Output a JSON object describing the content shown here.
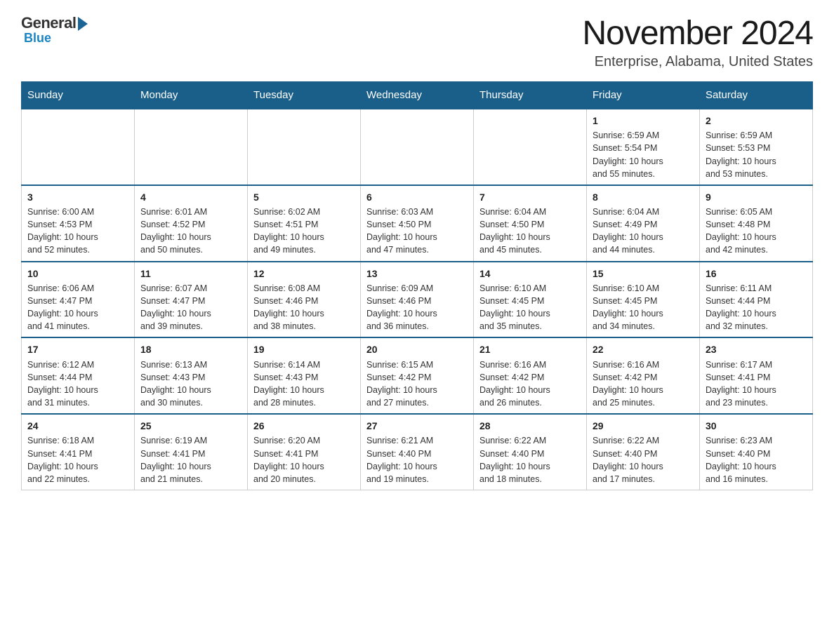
{
  "header": {
    "logo": {
      "general": "General",
      "blue": "Blue"
    },
    "title": "November 2024",
    "subtitle": "Enterprise, Alabama, United States"
  },
  "calendar": {
    "days_of_week": [
      "Sunday",
      "Monday",
      "Tuesday",
      "Wednesday",
      "Thursday",
      "Friday",
      "Saturday"
    ],
    "weeks": [
      {
        "days": [
          {
            "date": "",
            "info": ""
          },
          {
            "date": "",
            "info": ""
          },
          {
            "date": "",
            "info": ""
          },
          {
            "date": "",
            "info": ""
          },
          {
            "date": "",
            "info": ""
          },
          {
            "date": "1",
            "info": "Sunrise: 6:59 AM\nSunset: 5:54 PM\nDaylight: 10 hours\nand 55 minutes."
          },
          {
            "date": "2",
            "info": "Sunrise: 6:59 AM\nSunset: 5:53 PM\nDaylight: 10 hours\nand 53 minutes."
          }
        ]
      },
      {
        "days": [
          {
            "date": "3",
            "info": "Sunrise: 6:00 AM\nSunset: 4:53 PM\nDaylight: 10 hours\nand 52 minutes."
          },
          {
            "date": "4",
            "info": "Sunrise: 6:01 AM\nSunset: 4:52 PM\nDaylight: 10 hours\nand 50 minutes."
          },
          {
            "date": "5",
            "info": "Sunrise: 6:02 AM\nSunset: 4:51 PM\nDaylight: 10 hours\nand 49 minutes."
          },
          {
            "date": "6",
            "info": "Sunrise: 6:03 AM\nSunset: 4:50 PM\nDaylight: 10 hours\nand 47 minutes."
          },
          {
            "date": "7",
            "info": "Sunrise: 6:04 AM\nSunset: 4:50 PM\nDaylight: 10 hours\nand 45 minutes."
          },
          {
            "date": "8",
            "info": "Sunrise: 6:04 AM\nSunset: 4:49 PM\nDaylight: 10 hours\nand 44 minutes."
          },
          {
            "date": "9",
            "info": "Sunrise: 6:05 AM\nSunset: 4:48 PM\nDaylight: 10 hours\nand 42 minutes."
          }
        ]
      },
      {
        "days": [
          {
            "date": "10",
            "info": "Sunrise: 6:06 AM\nSunset: 4:47 PM\nDaylight: 10 hours\nand 41 minutes."
          },
          {
            "date": "11",
            "info": "Sunrise: 6:07 AM\nSunset: 4:47 PM\nDaylight: 10 hours\nand 39 minutes."
          },
          {
            "date": "12",
            "info": "Sunrise: 6:08 AM\nSunset: 4:46 PM\nDaylight: 10 hours\nand 38 minutes."
          },
          {
            "date": "13",
            "info": "Sunrise: 6:09 AM\nSunset: 4:46 PM\nDaylight: 10 hours\nand 36 minutes."
          },
          {
            "date": "14",
            "info": "Sunrise: 6:10 AM\nSunset: 4:45 PM\nDaylight: 10 hours\nand 35 minutes."
          },
          {
            "date": "15",
            "info": "Sunrise: 6:10 AM\nSunset: 4:45 PM\nDaylight: 10 hours\nand 34 minutes."
          },
          {
            "date": "16",
            "info": "Sunrise: 6:11 AM\nSunset: 4:44 PM\nDaylight: 10 hours\nand 32 minutes."
          }
        ]
      },
      {
        "days": [
          {
            "date": "17",
            "info": "Sunrise: 6:12 AM\nSunset: 4:44 PM\nDaylight: 10 hours\nand 31 minutes."
          },
          {
            "date": "18",
            "info": "Sunrise: 6:13 AM\nSunset: 4:43 PM\nDaylight: 10 hours\nand 30 minutes."
          },
          {
            "date": "19",
            "info": "Sunrise: 6:14 AM\nSunset: 4:43 PM\nDaylight: 10 hours\nand 28 minutes."
          },
          {
            "date": "20",
            "info": "Sunrise: 6:15 AM\nSunset: 4:42 PM\nDaylight: 10 hours\nand 27 minutes."
          },
          {
            "date": "21",
            "info": "Sunrise: 6:16 AM\nSunset: 4:42 PM\nDaylight: 10 hours\nand 26 minutes."
          },
          {
            "date": "22",
            "info": "Sunrise: 6:16 AM\nSunset: 4:42 PM\nDaylight: 10 hours\nand 25 minutes."
          },
          {
            "date": "23",
            "info": "Sunrise: 6:17 AM\nSunset: 4:41 PM\nDaylight: 10 hours\nand 23 minutes."
          }
        ]
      },
      {
        "days": [
          {
            "date": "24",
            "info": "Sunrise: 6:18 AM\nSunset: 4:41 PM\nDaylight: 10 hours\nand 22 minutes."
          },
          {
            "date": "25",
            "info": "Sunrise: 6:19 AM\nSunset: 4:41 PM\nDaylight: 10 hours\nand 21 minutes."
          },
          {
            "date": "26",
            "info": "Sunrise: 6:20 AM\nSunset: 4:41 PM\nDaylight: 10 hours\nand 20 minutes."
          },
          {
            "date": "27",
            "info": "Sunrise: 6:21 AM\nSunset: 4:40 PM\nDaylight: 10 hours\nand 19 minutes."
          },
          {
            "date": "28",
            "info": "Sunrise: 6:22 AM\nSunset: 4:40 PM\nDaylight: 10 hours\nand 18 minutes."
          },
          {
            "date": "29",
            "info": "Sunrise: 6:22 AM\nSunset: 4:40 PM\nDaylight: 10 hours\nand 17 minutes."
          },
          {
            "date": "30",
            "info": "Sunrise: 6:23 AM\nSunset: 4:40 PM\nDaylight: 10 hours\nand 16 minutes."
          }
        ]
      }
    ]
  }
}
